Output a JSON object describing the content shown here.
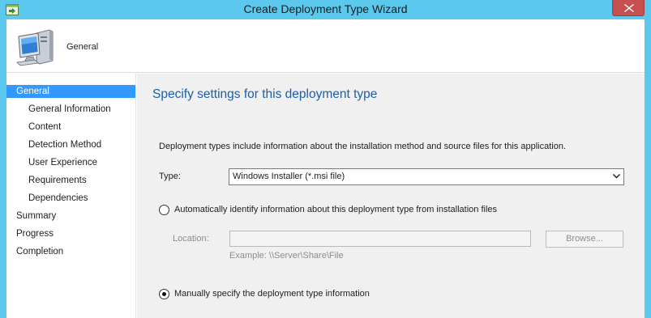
{
  "window": {
    "title": "Create Deployment Type Wizard"
  },
  "header": {
    "title": "General",
    "icon": "computer-icon"
  },
  "nav": {
    "items": [
      {
        "label": "General",
        "level": 0,
        "active": true
      },
      {
        "label": "General Information",
        "level": 1,
        "active": false
      },
      {
        "label": "Content",
        "level": 1,
        "active": false
      },
      {
        "label": "Detection Method",
        "level": 1,
        "active": false
      },
      {
        "label": "User Experience",
        "level": 1,
        "active": false
      },
      {
        "label": "Requirements",
        "level": 1,
        "active": false
      },
      {
        "label": "Dependencies",
        "level": 1,
        "active": false
      },
      {
        "label": "Summary",
        "level": 0,
        "active": false
      },
      {
        "label": "Progress",
        "level": 0,
        "active": false
      },
      {
        "label": "Completion",
        "level": 0,
        "active": false
      }
    ]
  },
  "content": {
    "heading": "Specify settings for this deployment type",
    "description": "Deployment types include information about the installation method and source files for this application.",
    "type": {
      "label": "Type:",
      "selected": "Windows Installer (*.msi file)"
    },
    "auto_option": {
      "label": "Automatically identify information about this deployment type from installation files",
      "checked": false
    },
    "location": {
      "label": "Location:",
      "value": "",
      "enabled": false
    },
    "browse_label": "Browse...",
    "example": "Example: \\\\Server\\Share\\File",
    "manual_option": {
      "label": "Manually specify the deployment type information",
      "checked": true
    }
  },
  "colors": {
    "titlebar": "#5bc8ee",
    "close": "#c74f50",
    "nav_active": "#3399ff",
    "heading": "#1d5ea8",
    "content_bg": "#f0f0f0"
  }
}
